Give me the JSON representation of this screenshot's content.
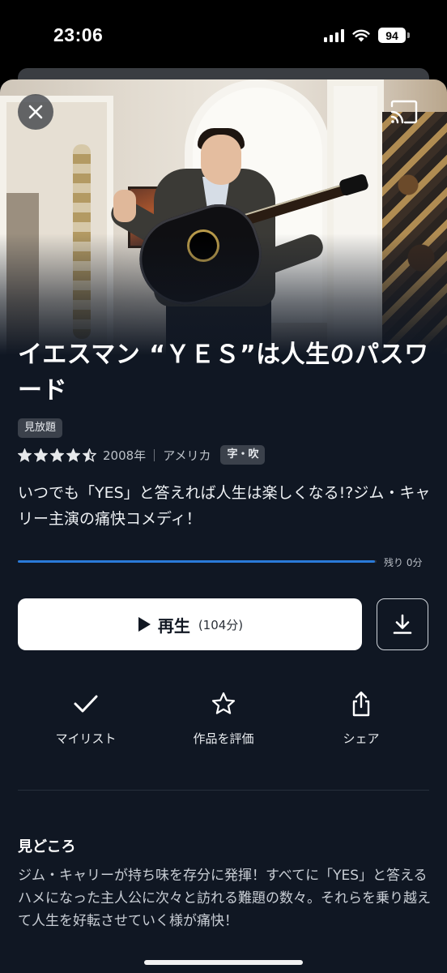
{
  "status_bar": {
    "time": "23:06",
    "battery": "94"
  },
  "hero": {
    "close_icon": "close-icon",
    "cast_icon": "cast-icon"
  },
  "title": "イエスマン “ＹＥＳ”は人生のパスワード",
  "badge_unlimited": "見放題",
  "meta": {
    "rating": 4.5,
    "rating_max": 5,
    "year": "2008年",
    "country": "アメリカ",
    "audio_badge": "字・吹"
  },
  "description": "いつでも「YES」と答えれば人生は楽しくなる!?ジム・キャリー主演の痛快コメディ！",
  "progress": {
    "fraction": 0.995,
    "label": "残り 0分"
  },
  "play_button": {
    "label": "再生",
    "duration": "(104分)"
  },
  "download_icon": "download-icon",
  "actions": [
    {
      "icon": "check-icon",
      "label": "マイリスト"
    },
    {
      "icon": "star-outline-icon",
      "label": "作品を評価"
    },
    {
      "icon": "share-icon",
      "label": "シェア"
    }
  ],
  "highlights": {
    "title": "見どころ",
    "body": "ジム・キャリーが持ち味を存分に発揮！すべてに「YES」と答えるハメになった主人公に次々と訪れる難題の数々。それらを乗り越えて人生を好転させていく様が痛快！"
  },
  "colors": {
    "background": "#101723",
    "accent": "#2a7ad8",
    "primary_button": "#ffffff"
  }
}
